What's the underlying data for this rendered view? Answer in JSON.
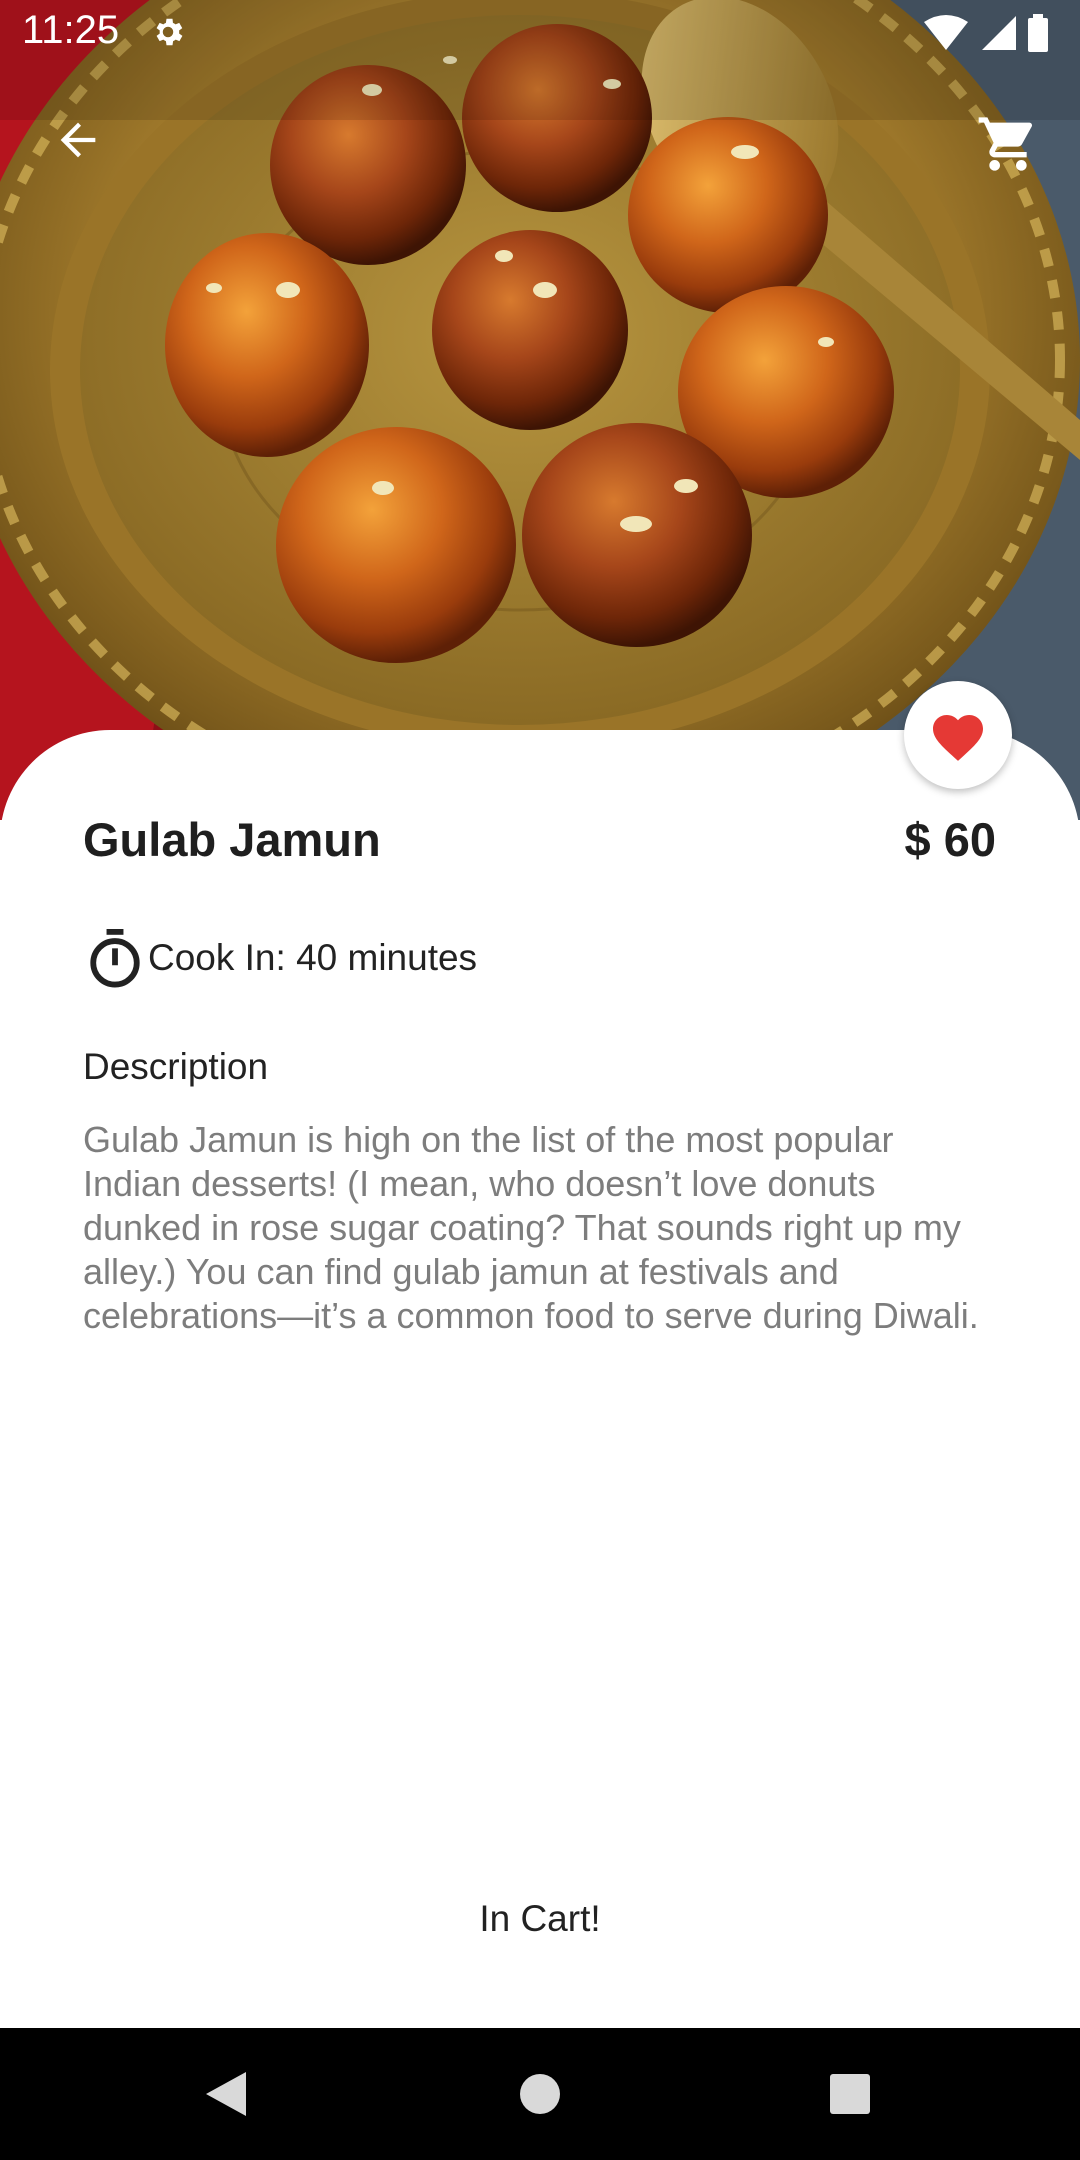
{
  "status_bar": {
    "time": "11:25",
    "icons": [
      "settings-icon",
      "wifi-icon",
      "signal-icon",
      "battery-icon"
    ]
  },
  "app_bar": {
    "back_icon": "arrow-back-icon",
    "cart_icon": "shopping-cart-icon"
  },
  "hero_image": {
    "subject": "gulab-jamun-on-brass-plate"
  },
  "favorite": {
    "icon": "heart-icon",
    "color": "#e53935",
    "active": true
  },
  "product": {
    "name": "Gulab Jamun",
    "price": "$ 60",
    "cook_time": "Cook In: 40 minutes",
    "description_label": "Description",
    "description": "Gulab Jamun is high on the list of the most popular Indian desserts! (I mean, who doesn’t love donuts dunked in rose sugar coating? That sounds right up my alley.) You can find gulab jamun at festivals and celebrations—it’s a common food to serve during Diwali."
  },
  "cart_status": "In Cart!",
  "nav_bar": {
    "items": [
      "back-triangle-icon",
      "home-circle-icon",
      "recents-square-icon"
    ]
  }
}
